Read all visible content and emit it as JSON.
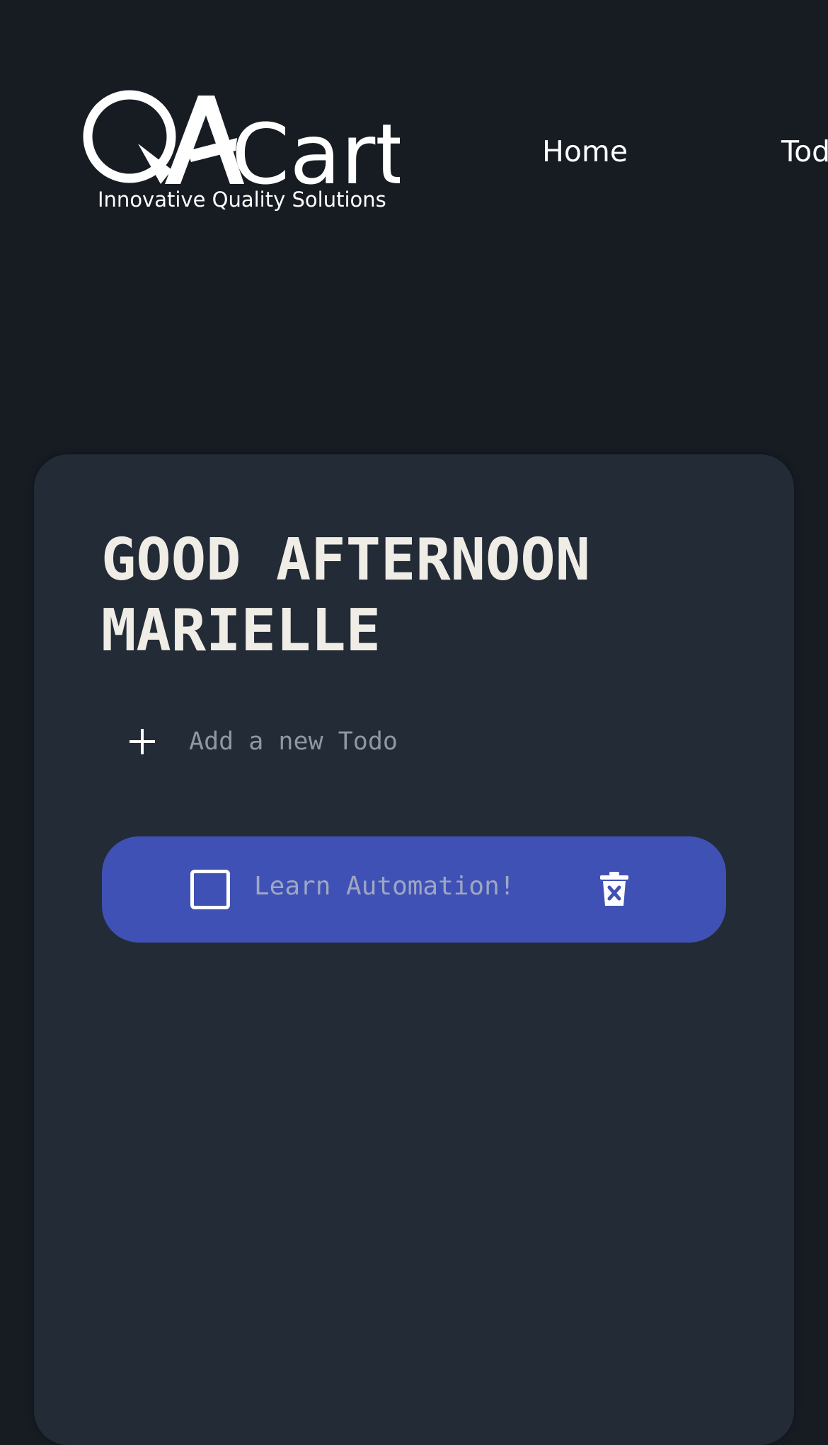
{
  "header": {
    "logo": {
      "brand_mark": "QA",
      "brand_name": "Cart",
      "tagline": "Innovative Quality Solutions"
    },
    "nav": [
      {
        "label": "Home"
      },
      {
        "label": "Tod"
      }
    ]
  },
  "main": {
    "greeting": "GOOD AFTERNOON MARIELLE",
    "add_todo": {
      "placeholder": "Add a new Todo",
      "icon": "plus-icon"
    },
    "todos": [
      {
        "text": "Learn Automation!",
        "completed": false,
        "delete_icon": "trash-icon"
      }
    ]
  },
  "colors": {
    "page_background": "#171c23",
    "card_background": "#222b36",
    "todo_background": "#4051b5",
    "heading_text": "#efede6",
    "placeholder_text": "#8e98a3",
    "todo_text": "#9ea7c2"
  }
}
